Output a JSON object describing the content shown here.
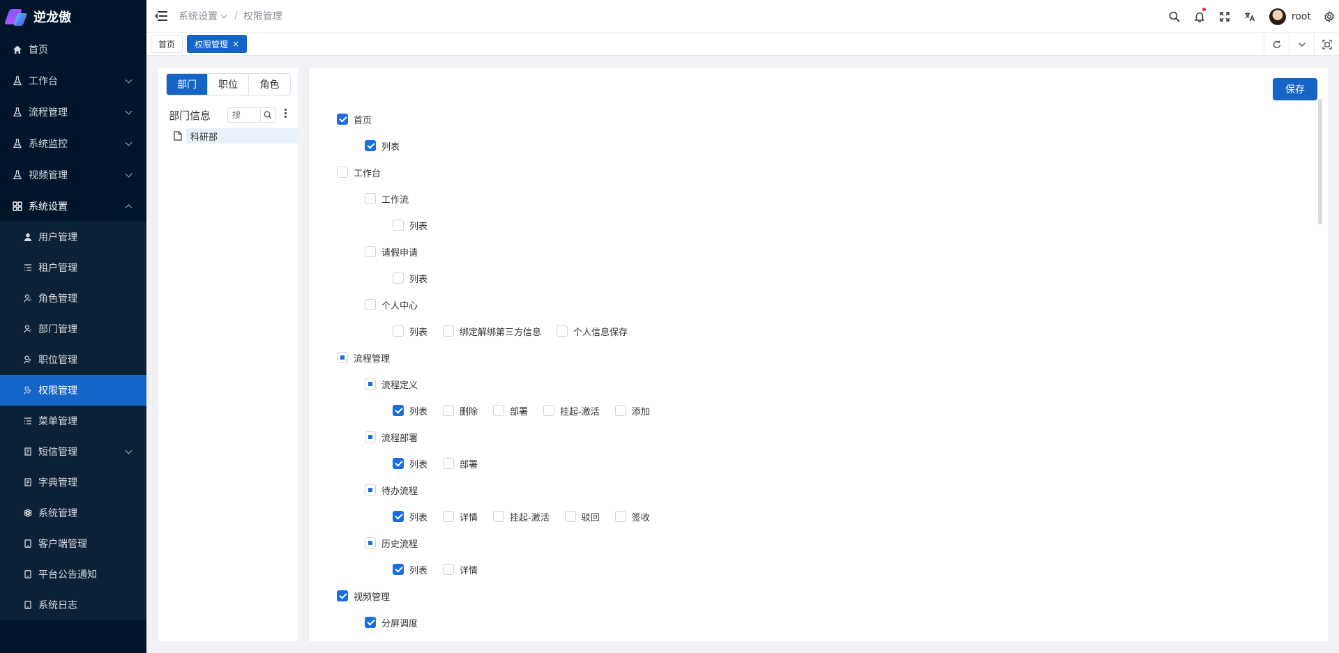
{
  "app": {
    "name": "逆龙傲"
  },
  "sidebar": {
    "items": [
      {
        "label": "首页",
        "icon": "home-icon",
        "name": "sidebar-item-home",
        "expandable": false
      },
      {
        "label": "工作台",
        "icon": "flask-icon",
        "name": "sidebar-item-workbench",
        "expandable": true
      },
      {
        "label": "流程管理",
        "icon": "flask-icon",
        "name": "sidebar-item-process",
        "expandable": true
      },
      {
        "label": "系统监控",
        "icon": "flask-icon",
        "name": "sidebar-item-monitor",
        "expandable": true
      },
      {
        "label": "视频管理",
        "icon": "flask-icon",
        "name": "sidebar-item-video",
        "expandable": true
      },
      {
        "label": "系统设置",
        "icon": "grid-icon",
        "name": "sidebar-item-settings",
        "expandable": true,
        "expanded": true
      }
    ],
    "submenu": [
      {
        "label": "用户管理",
        "icon": "user-icon"
      },
      {
        "label": "租户管理",
        "icon": "list-icon"
      },
      {
        "label": "角色管理",
        "icon": "user-outline-icon"
      },
      {
        "label": "部门管理",
        "icon": "user-outline-icon"
      },
      {
        "label": "职位管理",
        "icon": "user-key-icon"
      },
      {
        "label": "权限管理",
        "icon": "user-key-icon",
        "active": true
      },
      {
        "label": "菜单管理",
        "icon": "list-icon"
      },
      {
        "label": "短信管理",
        "icon": "doc-icon",
        "expandable": true
      },
      {
        "label": "字典管理",
        "icon": "doc-icon"
      },
      {
        "label": "系统管理",
        "icon": "cog-flower-icon"
      },
      {
        "label": "客户端管理",
        "icon": "tablet-icon"
      },
      {
        "label": "平台公告通知",
        "icon": "tablet-icon"
      },
      {
        "label": "系统日志",
        "icon": "tablet-icon"
      }
    ]
  },
  "header": {
    "breadcrumb": [
      "系统设置",
      "权限管理"
    ],
    "breadcrumb_sep": "/",
    "username": "root"
  },
  "tabs": [
    {
      "label": "首页",
      "active": false
    },
    {
      "label": "权限管理",
      "active": true,
      "close": "×"
    }
  ],
  "left": {
    "segments": [
      {
        "label": "部门",
        "on": true
      },
      {
        "label": "职位",
        "on": false
      },
      {
        "label": "角色",
        "on": false
      }
    ],
    "title": "部门信息",
    "search_placeholder": "搜",
    "tree": [
      "科研部"
    ]
  },
  "right": {
    "save_label": "保存",
    "permissions": [
      {
        "level": 0,
        "items": [
          {
            "label": "首页",
            "state": "checked"
          }
        ]
      },
      {
        "level": 1,
        "items": [
          {
            "label": "列表",
            "state": "checked"
          }
        ]
      },
      {
        "level": 0,
        "items": [
          {
            "label": "工作台",
            "state": "unchecked"
          }
        ]
      },
      {
        "level": 1,
        "items": [
          {
            "label": "工作流",
            "state": "unchecked"
          }
        ]
      },
      {
        "level": 2,
        "items": [
          {
            "label": "列表",
            "state": "unchecked"
          }
        ]
      },
      {
        "level": 1,
        "items": [
          {
            "label": "请假申请",
            "state": "unchecked"
          }
        ]
      },
      {
        "level": 2,
        "items": [
          {
            "label": "列表",
            "state": "unchecked"
          }
        ]
      },
      {
        "level": 1,
        "items": [
          {
            "label": "个人中心",
            "state": "unchecked"
          }
        ]
      },
      {
        "level": 2,
        "items": [
          {
            "label": "列表",
            "state": "unchecked"
          },
          {
            "label": "绑定解绑第三方信息",
            "state": "unchecked"
          },
          {
            "label": "个人信息保存",
            "state": "unchecked"
          }
        ]
      },
      {
        "level": 0,
        "items": [
          {
            "label": "流程管理",
            "state": "partial"
          }
        ]
      },
      {
        "level": 1,
        "items": [
          {
            "label": "流程定义",
            "state": "partial"
          }
        ]
      },
      {
        "level": 2,
        "items": [
          {
            "label": "列表",
            "state": "checked"
          },
          {
            "label": "删除",
            "state": "unchecked"
          },
          {
            "label": "部署",
            "state": "unchecked"
          },
          {
            "label": "挂起-激活",
            "state": "unchecked"
          },
          {
            "label": "添加",
            "state": "unchecked"
          }
        ]
      },
      {
        "level": 1,
        "items": [
          {
            "label": "流程部署",
            "state": "partial"
          }
        ]
      },
      {
        "level": 2,
        "items": [
          {
            "label": "列表",
            "state": "checked"
          },
          {
            "label": "部署",
            "state": "unchecked"
          }
        ]
      },
      {
        "level": 1,
        "items": [
          {
            "label": "待办流程",
            "state": "partial"
          }
        ]
      },
      {
        "level": 2,
        "items": [
          {
            "label": "列表",
            "state": "checked"
          },
          {
            "label": "详情",
            "state": "unchecked"
          },
          {
            "label": "挂起-激活",
            "state": "unchecked"
          },
          {
            "label": "驳回",
            "state": "unchecked"
          },
          {
            "label": "签收",
            "state": "unchecked"
          }
        ]
      },
      {
        "level": 1,
        "items": [
          {
            "label": "历史流程",
            "state": "partial"
          }
        ]
      },
      {
        "level": 2,
        "items": [
          {
            "label": "列表",
            "state": "checked"
          },
          {
            "label": "详情",
            "state": "unchecked"
          }
        ]
      },
      {
        "level": 0,
        "items": [
          {
            "label": "视频管理",
            "state": "checked"
          }
        ]
      },
      {
        "level": 1,
        "items": [
          {
            "label": "分屏调度",
            "state": "checked"
          }
        ]
      }
    ]
  },
  "colors": {
    "primary": "#1565c8",
    "sidebar_bg": "#001529",
    "checkbox": "#1a6fe0"
  }
}
